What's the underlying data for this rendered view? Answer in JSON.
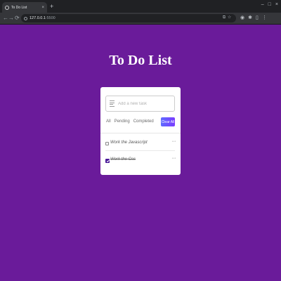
{
  "browser": {
    "tab_title": "To Do List",
    "new_tab_glyph": "+",
    "close_glyph": "×",
    "url_host": "127.0.0.1",
    "url_port": ":5500",
    "nav_back": "←",
    "nav_forward": "→",
    "nav_reload": "⟳",
    "window_min": "–",
    "window_max": "□",
    "window_close": "×"
  },
  "app": {
    "title": "To Do List",
    "input": {
      "placeholder": "Add a new task",
      "value": ""
    },
    "filters": [
      "All",
      "Pending",
      "Completed"
    ],
    "clear_label": "Clear All",
    "menu_glyph": "···",
    "tasks": [
      {
        "text": "Work the Javascript",
        "completed": false
      },
      {
        "text": "Work the Css",
        "completed": true
      }
    ]
  },
  "colors": {
    "page_background": "#6a1b9a",
    "card_background": "#ffffff",
    "accent": "#5e6bff",
    "checkbox_checked": "#4a1a99"
  }
}
